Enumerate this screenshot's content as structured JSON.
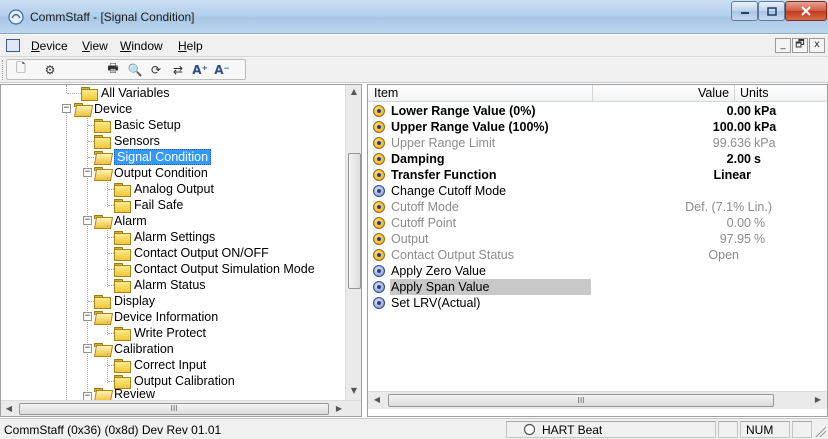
{
  "window": {
    "title": "CommStaff - [Signal Condition]"
  },
  "menu": {
    "items": [
      {
        "label": "Device",
        "accel": "D",
        "rest": "evice"
      },
      {
        "label": "View",
        "accel": "V",
        "rest": "iew"
      },
      {
        "label": "Window",
        "accel": "W",
        "rest": "indow"
      },
      {
        "label": "Help",
        "accel": "H",
        "rest": "elp"
      }
    ],
    "mdi_buttons": [
      "_",
      "🗗",
      "x"
    ]
  },
  "toolbar": {
    "icons": [
      "new-document-icon",
      "device-connect-icon",
      "print-icon",
      "search-device-icon",
      "refresh-icon",
      "transfer-icon",
      "font-increase-icon",
      "font-decrease-icon"
    ],
    "glyphs": [
      "🗋",
      "⚙",
      "🖶",
      "🔍",
      "⟳",
      "⇄",
      "A⁺",
      "A⁻"
    ]
  },
  "tree": {
    "items": [
      {
        "label": "All Variables",
        "level": 2,
        "expander": null
      },
      {
        "label": "Device",
        "level": 1,
        "expander": "−"
      },
      {
        "label": "Basic Setup",
        "level": 2,
        "expander": null
      },
      {
        "label": "Sensors",
        "level": 2,
        "expander": null
      },
      {
        "label": "Signal Condition",
        "level": 2,
        "expander": null,
        "selected": true
      },
      {
        "label": "Output Condition",
        "level": 2,
        "expander": "−"
      },
      {
        "label": "Analog Output",
        "level": 3,
        "expander": null
      },
      {
        "label": "Fail Safe",
        "level": 3,
        "expander": null
      },
      {
        "label": "Alarm",
        "level": 2,
        "expander": "−"
      },
      {
        "label": "Alarm Settings",
        "level": 3,
        "expander": null
      },
      {
        "label": "Contact Output ON/OFF",
        "level": 3,
        "expander": null
      },
      {
        "label": "Contact Output Simulation Mode",
        "level": 3,
        "expander": null
      },
      {
        "label": "Alarm Status",
        "level": 3,
        "expander": null
      },
      {
        "label": "Display",
        "level": 2,
        "expander": null
      },
      {
        "label": "Device Information",
        "level": 2,
        "expander": "−"
      },
      {
        "label": "Write Protect",
        "level": 3,
        "expander": null
      },
      {
        "label": "Calibration",
        "level": 2,
        "expander": "−"
      },
      {
        "label": "Correct Input",
        "level": 3,
        "expander": null
      },
      {
        "label": "Output Calibration",
        "level": 3,
        "expander": null
      },
      {
        "label": "Review",
        "level": 2,
        "expander": "−"
      }
    ],
    "hscroll_mark": "III"
  },
  "list": {
    "headers": {
      "item": "Item",
      "value": "Value",
      "units": "Units"
    },
    "rows": [
      {
        "name": "Lower Range Value (0%)",
        "value": "0.00",
        "unit": "kPa",
        "style": "bold",
        "icon": "variable"
      },
      {
        "name": "Upper Range Value (100%)",
        "value": "100.00",
        "unit": "kPa",
        "style": "bold",
        "icon": "variable"
      },
      {
        "name": "Upper Range Limit",
        "value": "99.636",
        "unit": "kPa",
        "style": "grey",
        "icon": "variable"
      },
      {
        "name": "Damping",
        "value": "2.00",
        "unit": "s",
        "style": "bold",
        "icon": "variable"
      },
      {
        "name": "Transfer Function",
        "value": "Linear",
        "unit": "",
        "style": "bold",
        "icon": "variable"
      },
      {
        "name": "Change Cutoff Mode",
        "value": "",
        "unit": "",
        "style": "normal",
        "icon": "method"
      },
      {
        "name": "Cutoff Mode",
        "value": "Def. (7.1% Lin.)",
        "unit": "",
        "style": "grey",
        "icon": "variable"
      },
      {
        "name": "Cutoff Point",
        "value": "0.00",
        "unit": "%",
        "style": "grey",
        "icon": "variable"
      },
      {
        "name": "Output",
        "value": "97.95",
        "unit": "%",
        "style": "grey",
        "icon": "variable"
      },
      {
        "name": "Contact Output Status",
        "value": "Open",
        "unit": "",
        "style": "grey",
        "icon": "variable"
      },
      {
        "name": "Apply Zero Value",
        "value": "",
        "unit": "",
        "style": "normal",
        "icon": "method"
      },
      {
        "name": "Apply Span Value",
        "value": "",
        "unit": "",
        "style": "normal",
        "icon": "method",
        "highlighted": true
      },
      {
        "name": "Set LRV(Actual)",
        "value": "",
        "unit": "",
        "style": "normal",
        "icon": "method"
      }
    ],
    "hscroll_mark": "III"
  },
  "status": {
    "device": "CommStaff  (0x36) (0x8d) Dev Rev 01.01",
    "hart": "HART Beat",
    "num": "NUM"
  }
}
